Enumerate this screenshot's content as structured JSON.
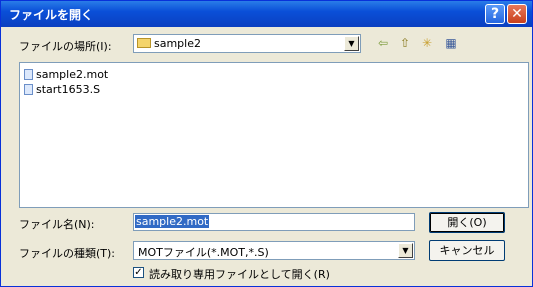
{
  "window": {
    "title": "ファイルを開く",
    "help_glyph": "?",
    "close_glyph": "✕"
  },
  "location": {
    "label": "ファイルの場所(I):",
    "value": "sample2"
  },
  "files": [
    "sample2.mot",
    "start1653.S"
  ],
  "filename": {
    "label": "ファイル名(N):",
    "value": "sample2.mot"
  },
  "filetype": {
    "label": "ファイルの種類(T):",
    "value": "MOTファイル(*.MOT,*.S)"
  },
  "buttons": {
    "open": "開く(O)",
    "cancel": "キャンセル"
  },
  "readonly": {
    "label": "読み取り専用ファイルとして開く(R)",
    "checked": true,
    "check_glyph": "✓"
  },
  "toolbar_glyphs": {
    "back": "⇦",
    "up": "⇧",
    "new_folder": "✳",
    "view": "▦"
  },
  "colors": {
    "titlebar": "#0a4fd8",
    "selection": "#316ac5",
    "face": "#ece9d8"
  }
}
